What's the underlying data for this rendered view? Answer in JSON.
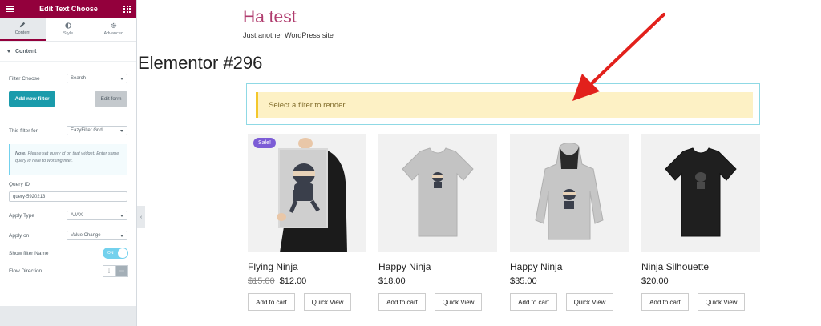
{
  "panel": {
    "title": "Edit Text Choose",
    "tabs": [
      {
        "label": "Content",
        "icon": "pencil-icon"
      },
      {
        "label": "Style",
        "icon": "half-circle-icon"
      },
      {
        "label": "Advanced",
        "icon": "gear-icon"
      }
    ],
    "section_title": "Content",
    "filter_choose_label": "Filter Choose",
    "filter_choose_value": "Search",
    "add_filter_label": "Add new filter",
    "edit_form_label": "Edit form",
    "filter_for_label": "This filter for",
    "filter_for_value": "EazyFilter Grid",
    "note_bold": "Note!",
    "note_text": "Please set query id on that widget. Enter same query id here to working filter.",
    "query_id_label": "Query ID",
    "query_id_value": "query-5920213",
    "apply_type_label": "Apply Type",
    "apply_type_value": "AJAX",
    "apply_on_label": "Apply on",
    "apply_on_value": "Value Change",
    "show_filter_name_label": "Show filter Name",
    "show_filter_name_toggle": "ON",
    "flow_direction_label": "Flow Direction",
    "flow_vertical_glyph": "⋮",
    "flow_horizontal_glyph": "⋯",
    "collapse_glyph": "‹",
    "accent_color": "#93003c"
  },
  "site": {
    "title": "Ha test",
    "tagline": "Just another WordPress site",
    "page_title": "Elementor #296",
    "alert_text": "Select a filter to render."
  },
  "products": [
    {
      "name": "Flying Ninja",
      "old_price": "$15.00",
      "price": "$12.00",
      "sale": "Sale!",
      "add_to_cart": "Add to cart",
      "quick_view": "Quick View"
    },
    {
      "name": "Happy Ninja",
      "old_price": "",
      "price": "$18.00",
      "sale": "",
      "add_to_cart": "Add to cart",
      "quick_view": "Quick View"
    },
    {
      "name": "Happy Ninja",
      "old_price": "",
      "price": "$35.00",
      "sale": "",
      "add_to_cart": "Add to cart",
      "quick_view": "Quick View"
    },
    {
      "name": "Ninja Silhouette",
      "old_price": "",
      "price": "$20.00",
      "sale": "",
      "add_to_cart": "Add to cart",
      "quick_view": "Quick View"
    }
  ]
}
